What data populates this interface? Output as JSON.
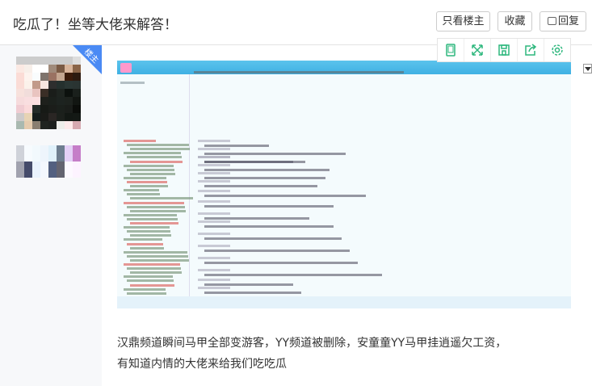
{
  "header": {
    "title": "吃瓜了！坐等大佬来解答！",
    "buttons": {
      "only_op": "只看楼主",
      "favorite": "收藏",
      "reply": "回复"
    }
  },
  "author": {
    "badge": "楼主"
  },
  "toolbar": {
    "icons": [
      "tablet-icon",
      "fullscreen-icon",
      "save-icon",
      "share-icon",
      "settings-icon"
    ]
  },
  "post": {
    "lines": [
      "汉鼎频道瞬间马甲全部变游客，YY频道被删除，安童童YY马甲挂逍遥欠工资，",
      "有知道内情的大佬来给我们吃吃瓜"
    ]
  },
  "colors": {
    "accent": "#2db77d",
    "badge": "#4a8af4",
    "chat_bar": "#4ab9e8"
  }
}
